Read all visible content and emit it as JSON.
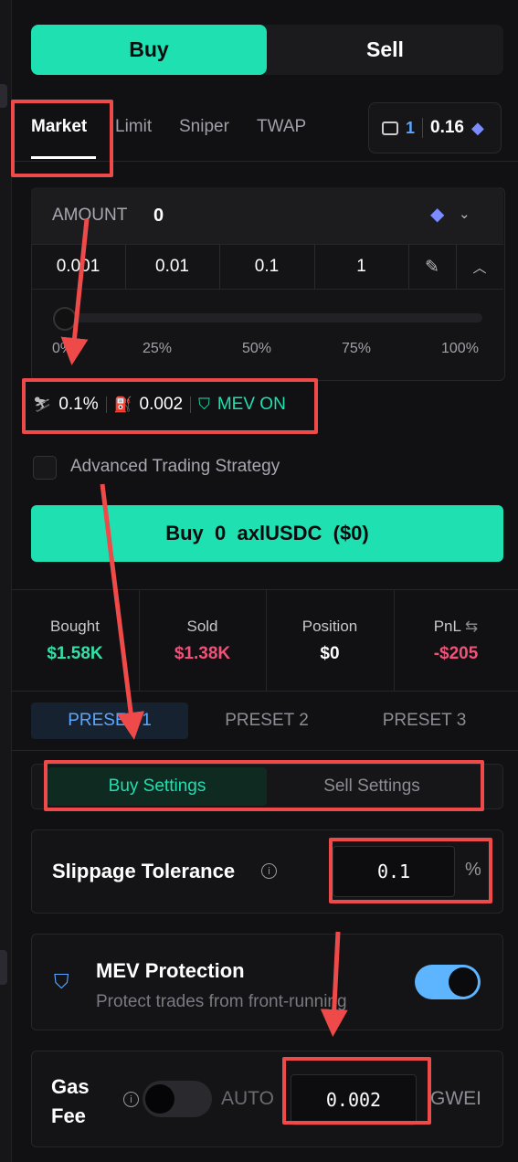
{
  "trade_tabs": {
    "buy": "Buy",
    "sell": "Sell"
  },
  "order_types": [
    "Market",
    "Limit",
    "Sniper",
    "TWAP"
  ],
  "wallet": {
    "count": "1",
    "balance": "0.16"
  },
  "amount": {
    "label": "AMOUNT",
    "value": "0",
    "quick": [
      "0.001",
      "0.01",
      "0.1",
      "1"
    ],
    "slider_percent": 0,
    "slider_marks": [
      "0%",
      "25%",
      "50%",
      "75%",
      "100%"
    ]
  },
  "stats": {
    "slippage": "0.1%",
    "gas": "0.002",
    "mev": "MEV ON"
  },
  "advanced": {
    "label": "Advanced Trading Strategy"
  },
  "buy_button": {
    "text": "Buy  0  axlUSDC  ($0)"
  },
  "summary": [
    {
      "label": "Bought",
      "value": "$1.58K",
      "color": "#33e0a6"
    },
    {
      "label": "Sold",
      "value": "$1.38K",
      "color": "#f0527a"
    },
    {
      "label": "Position",
      "value": "$0",
      "color": "#ffffff"
    },
    {
      "label": "PnL",
      "value": "-$205",
      "color": "#f0527a"
    }
  ],
  "presets": [
    "PRESET 1",
    "PRESET 2",
    "PRESET 3"
  ],
  "settings_tabs": {
    "buy": "Buy Settings",
    "sell": "Sell Settings"
  },
  "slippage": {
    "label": "Slippage Tolerance",
    "value": "0.1",
    "unit": "%"
  },
  "mev": {
    "title": "MEV Protection",
    "desc": "Protect trades from front-running",
    "enabled": true
  },
  "gas": {
    "label_line1": "Gas",
    "label_line2": "Fee",
    "auto": "AUTO",
    "value": "0.002",
    "unit": "GWEI",
    "auto_enabled": false
  },
  "colors": {
    "accent": "#1ee0b0",
    "highlight": "#ef4a4a",
    "blue": "#5aa6ff"
  }
}
